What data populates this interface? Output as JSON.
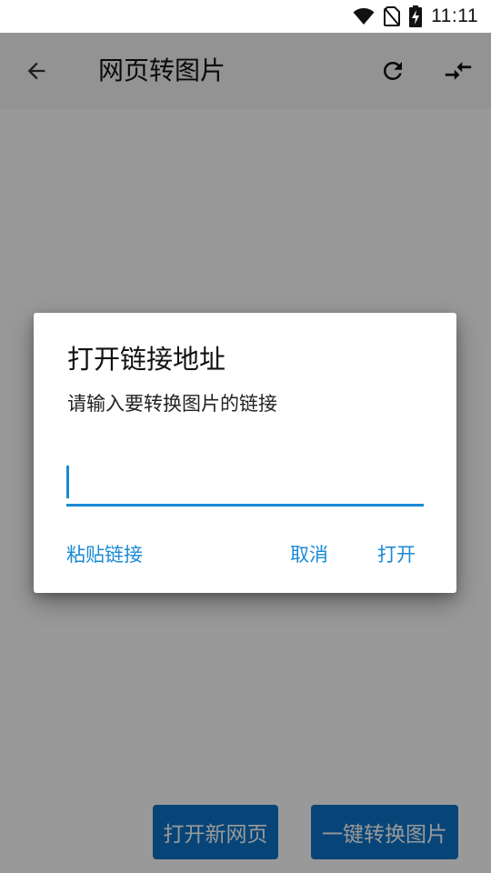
{
  "status_bar": {
    "time": "11:11",
    "icons": [
      "wifi-icon",
      "no-sim-icon",
      "battery-charging-icon"
    ]
  },
  "app_bar": {
    "title": "网页转图片",
    "back_icon": "arrow-left-icon",
    "refresh_icon": "refresh-icon",
    "compare_icon": "compare-arrows-icon"
  },
  "bottom_bar": {
    "open_new_page_label": "打开新网页",
    "convert_label": "一键转换图片"
  },
  "dialog": {
    "title": "打开链接地址",
    "message": "请输入要转换图片的链接",
    "input_value": "",
    "paste_label": "粘贴链接",
    "cancel_label": "取消",
    "open_label": "打开"
  },
  "colors": {
    "accent": "#1a8ad4",
    "button_bg": "#0d73c9",
    "scrim": "rgba(0,0,0,0.40)"
  }
}
